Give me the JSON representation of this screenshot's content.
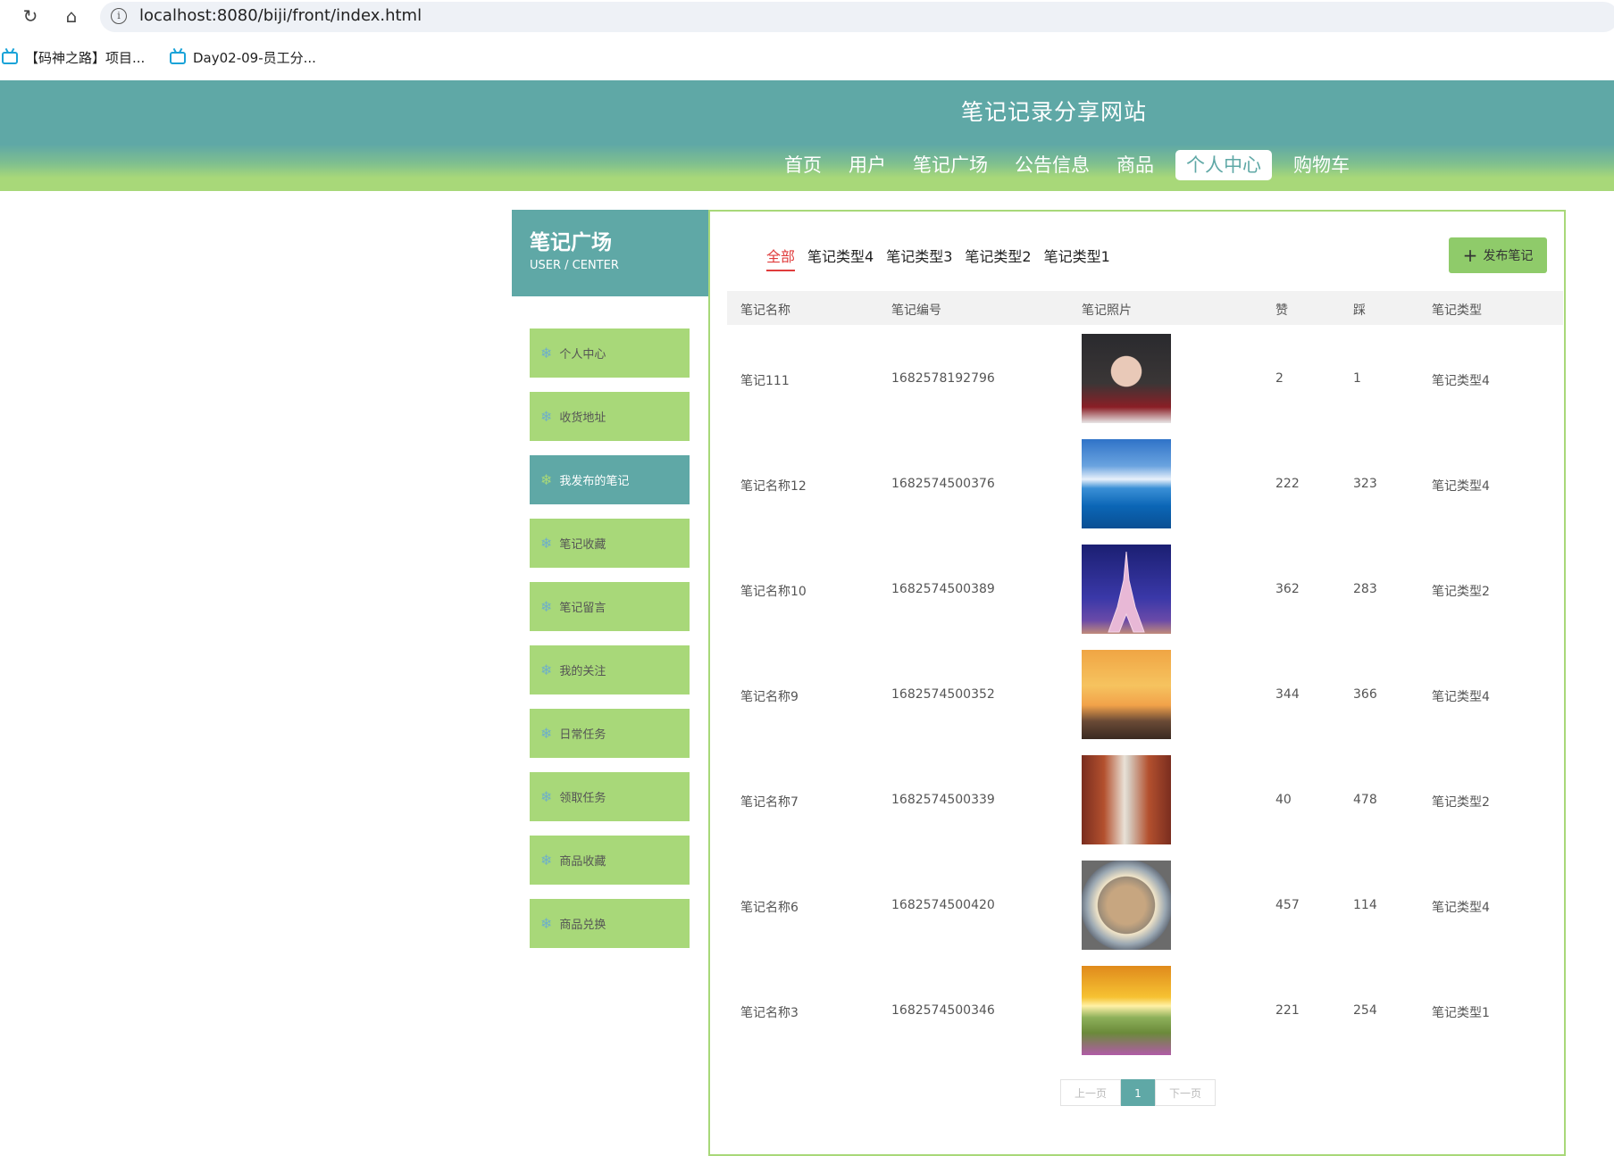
{
  "browser": {
    "url": "localhost:8080/biji/front/index.html",
    "bookmarks": [
      {
        "label": "【码神之路】项目..."
      },
      {
        "label": "Day02-09-员工分..."
      }
    ]
  },
  "site": {
    "title": "笔记记录分享网站",
    "nav": [
      "首页",
      "用户",
      "笔记广场",
      "公告信息",
      "商品",
      "个人中心",
      "购物车"
    ],
    "nav_active": "个人中心"
  },
  "sidebar": {
    "title": "笔记广场",
    "subtitle": "USER / CENTER",
    "items": [
      {
        "label": "个人中心"
      },
      {
        "label": "收货地址"
      },
      {
        "label": "我发布的笔记",
        "active": true
      },
      {
        "label": "笔记收藏"
      },
      {
        "label": "笔记留言"
      },
      {
        "label": "我的关注"
      },
      {
        "label": "日常任务"
      },
      {
        "label": "领取任务"
      },
      {
        "label": "商品收藏"
      },
      {
        "label": "商品兑换"
      }
    ]
  },
  "main": {
    "tabs": [
      "全部",
      "笔记类型4",
      "笔记类型3",
      "笔记类型2",
      "笔记类型1"
    ],
    "publish_label": "发布笔记",
    "columns": [
      "笔记名称",
      "笔记编号",
      "笔记照片",
      "赞",
      "踩",
      "笔记类型"
    ],
    "rows": [
      {
        "name": "笔记111",
        "id": "1682578192796",
        "photo": "portrait",
        "like": "2",
        "dislike": "1",
        "type": "笔记类型4"
      },
      {
        "name": "笔记名称12",
        "id": "1682574500376",
        "photo": "sea-sky",
        "like": "222",
        "dislike": "323",
        "type": "笔记类型4"
      },
      {
        "name": "笔记名称10",
        "id": "1682574500389",
        "photo": "eiffel-tower",
        "like": "362",
        "dislike": "283",
        "type": "笔记类型2"
      },
      {
        "name": "笔记名称9",
        "id": "1682574500352",
        "photo": "sunset-rainbow",
        "like": "344",
        "dislike": "366",
        "type": "笔记类型4"
      },
      {
        "name": "笔记名称7",
        "id": "1682574500339",
        "photo": "corridor",
        "like": "40",
        "dislike": "478",
        "type": "笔记类型2"
      },
      {
        "name": "笔记名称6",
        "id": "1682574500420",
        "photo": "desert-fisheye",
        "like": "457",
        "dislike": "114",
        "type": "笔记类型4"
      },
      {
        "name": "笔记名称3",
        "id": "1682574500346",
        "photo": "flower-field-sunset",
        "like": "221",
        "dislike": "254",
        "type": "笔记类型1"
      }
    ]
  },
  "pagination": {
    "prev": "上一页",
    "current": "1",
    "next": "下一页"
  },
  "colors": {
    "teal": "#5fa8a6",
    "green": "#a8d879",
    "active_tab": "#e03c3c"
  }
}
